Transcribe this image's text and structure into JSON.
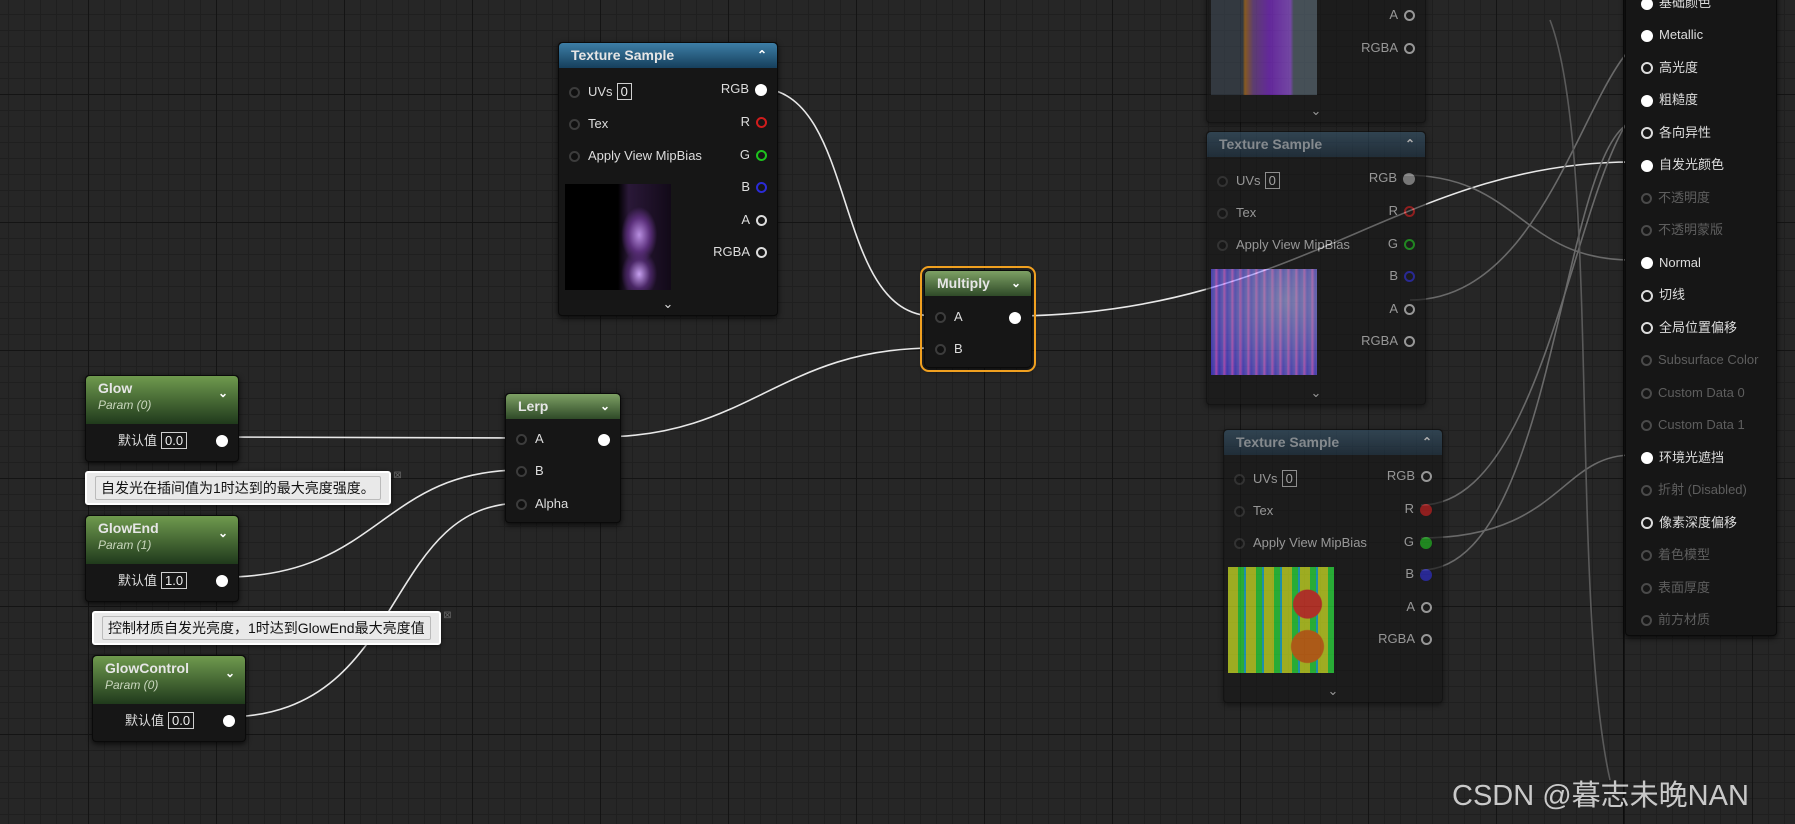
{
  "colors": {
    "selection_outline": "#f0a020",
    "param_header": "#5b8a3f",
    "texture_header": "#2f6f96",
    "math_header": "#6a8a5a"
  },
  "texture1": {
    "title": "Texture Sample",
    "uvs_label": "UVs",
    "uvs_value": "0",
    "tex_label": "Tex",
    "mip_label": "Apply View MipBias",
    "outputs": [
      "RGB",
      "R",
      "G",
      "B",
      "A",
      "RGBA"
    ],
    "expand_icon": "chevron-down-icon"
  },
  "texture_top": {
    "outputs": [
      "A",
      "RGBA"
    ]
  },
  "texture2": {
    "title": "Texture Sample",
    "uvs_label": "UVs",
    "uvs_value": "0",
    "tex_label": "Tex",
    "mip_label": "Apply View MipBias",
    "outputs": [
      "RGB",
      "R",
      "G",
      "B",
      "A",
      "RGBA"
    ]
  },
  "texture3": {
    "title": "Texture Sample",
    "uvs_label": "UVs",
    "uvs_value": "0",
    "tex_label": "Tex",
    "mip_label": "Apply View MipBias",
    "outputs": [
      "RGB",
      "R",
      "G",
      "B",
      "A",
      "RGBA"
    ]
  },
  "multiply": {
    "title": "Multiply",
    "in_a": "A",
    "in_b": "B"
  },
  "lerp": {
    "title": "Lerp",
    "in_a": "A",
    "in_b": "B",
    "in_alpha": "Alpha"
  },
  "glow": {
    "title": "Glow",
    "subtitle": "Param (0)",
    "default_label": "默认值",
    "value": "0.0"
  },
  "glowend": {
    "title": "GlowEnd",
    "subtitle": "Param (1)",
    "default_label": "默认值",
    "value": "1.0"
  },
  "glowcontrol": {
    "title": "GlowControl",
    "subtitle": "Param (0)",
    "default_label": "默认值",
    "value": "0.0"
  },
  "comments": {
    "glowend": "自发光在插间值为1时达到的最大亮度强度。",
    "glowcontrol": "控制材质自发光亮度，1时达到GlowEnd最大亮度值"
  },
  "result": {
    "top_partial": "基础颜色",
    "inputs": [
      {
        "label": "Metallic",
        "state": "filled"
      },
      {
        "label": "高光度",
        "state": "ring"
      },
      {
        "label": "粗糙度",
        "state": "filled"
      },
      {
        "label": "各向异性",
        "state": "ring"
      },
      {
        "label": "自发光颜色",
        "state": "filled"
      },
      {
        "label": "不透明度",
        "state": "disabled"
      },
      {
        "label": "不透明蒙版",
        "state": "disabled"
      },
      {
        "label": "Normal",
        "state": "filled"
      },
      {
        "label": "切线",
        "state": "ring"
      },
      {
        "label": "全局位置偏移",
        "state": "ring"
      },
      {
        "label": "Subsurface Color",
        "state": "disabled"
      },
      {
        "label": "Custom Data 0",
        "state": "disabled"
      },
      {
        "label": "Custom Data 1",
        "state": "disabled"
      },
      {
        "label": "环境光遮挡",
        "state": "filled"
      },
      {
        "label": "折射 (Disabled)",
        "state": "disabled"
      },
      {
        "label": "像素深度偏移",
        "state": "ring"
      },
      {
        "label": "着色模型",
        "state": "disabled"
      },
      {
        "label": "表面厚度",
        "state": "disabled"
      },
      {
        "label": "前方材质",
        "state": "disabled"
      }
    ]
  },
  "watermark": "CSDN @暮志未晚NAN"
}
